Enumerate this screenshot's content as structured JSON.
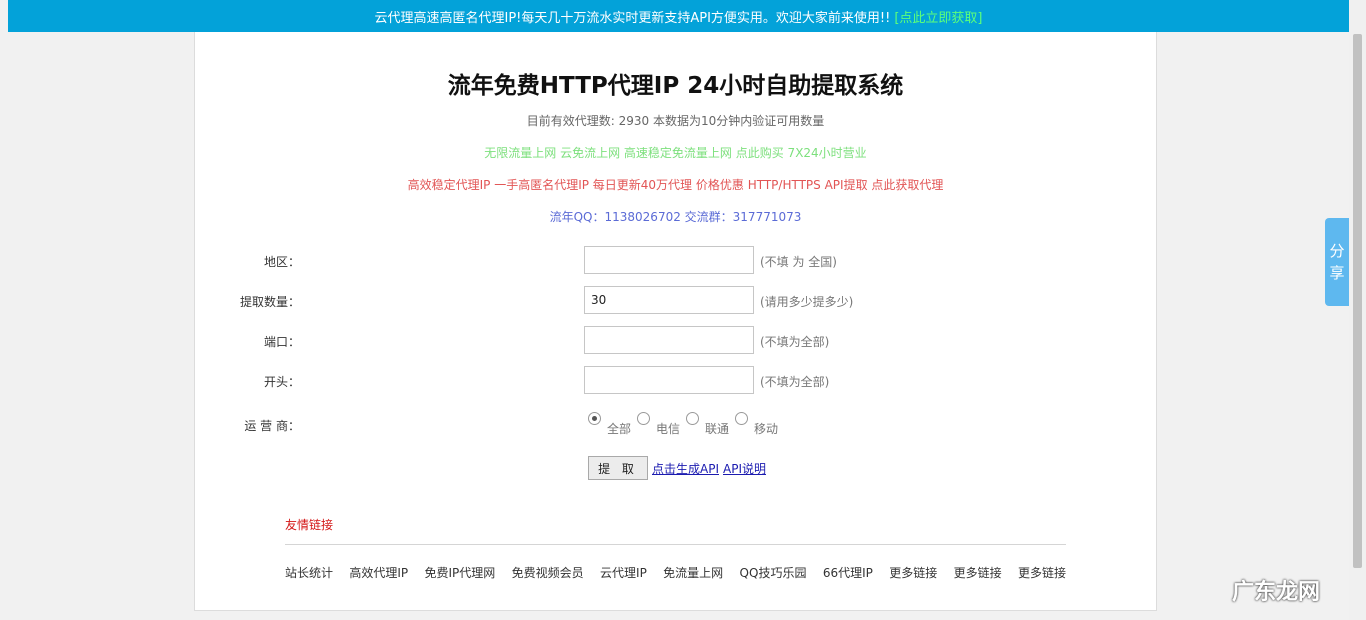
{
  "topbar": {
    "message": "云代理高速高匿名代理IP!每天几十万流水实时更新支持API方便实用。欢迎大家前来使用!!",
    "link": "[点此立即获取]"
  },
  "header": {
    "title": "流年免费HTTP代理IP 24小时自助提取系统",
    "status": "目前有效代理数: 2930 本数据为10分钟内验证可用数量",
    "promo_green": "无限流量上网 云免流上网 高速稳定免流量上网 点此购买 7X24小时营业",
    "promo_red": "高效稳定代理IP 一手高匿名代理IP 每日更新40万代理 价格优惠 HTTP/HTTPS API提取 点此获取代理",
    "contact": "流年QQ：1138026702 交流群：317771073"
  },
  "form": {
    "region": {
      "label": "地区：",
      "value": "",
      "hint": "(不填 为 全国)"
    },
    "count": {
      "label": "提取数量：",
      "value": "30",
      "hint": "(请用多少提多少)"
    },
    "port": {
      "label": "端口：",
      "value": "",
      "hint": "(不填为全部)"
    },
    "prefix": {
      "label": "开头：",
      "value": "",
      "hint": "(不填为全部)"
    },
    "isp": {
      "label": "运 营 商：",
      "options": [
        {
          "label": "全部",
          "checked": true
        },
        {
          "label": "电信",
          "checked": false
        },
        {
          "label": "联通",
          "checked": false
        },
        {
          "label": "移动",
          "checked": false
        }
      ]
    },
    "submit_label": "提 取",
    "api_link": "点击生成API",
    "api_doc_link": "API说明"
  },
  "friend_links": {
    "title": "友情链接",
    "items": [
      "站长统计",
      "高效代理IP",
      "免费IP代理网",
      "免费视频会员",
      "云代理IP",
      "免流量上网",
      "QQ技巧乐园",
      "66代理IP",
      "更多链接",
      "更多链接",
      "更多链接"
    ]
  },
  "share": {
    "line1": "分",
    "line2": "享"
  },
  "watermark": "广东龙网"
}
